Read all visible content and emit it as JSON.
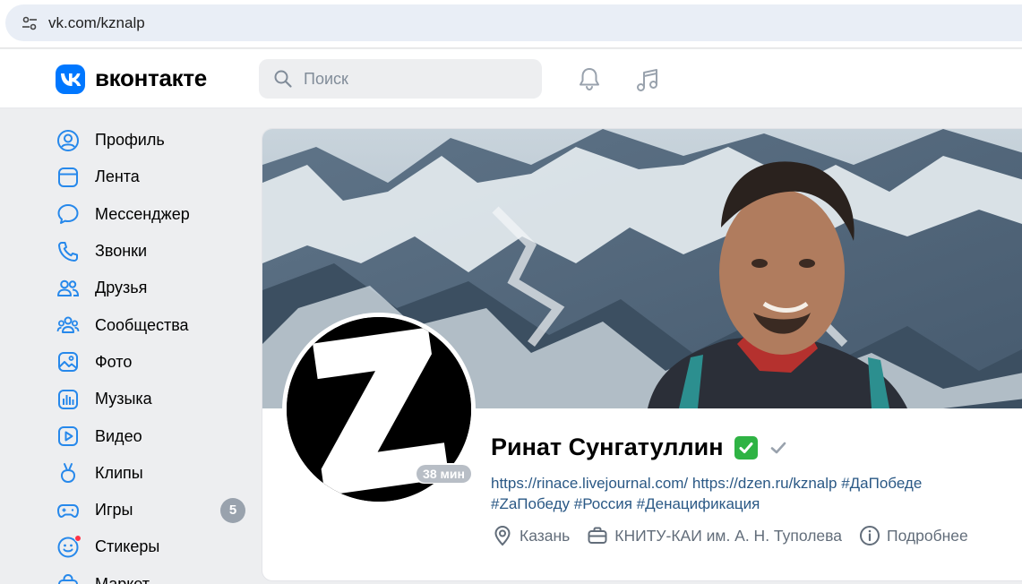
{
  "browser": {
    "url": "vk.com/kznalp"
  },
  "header": {
    "wordmark": "вконтакте",
    "search_placeholder": "Поиск",
    "accent_color": "#0077ff"
  },
  "sidebar": {
    "items": [
      {
        "label": "Профиль",
        "icon": "profile-icon"
      },
      {
        "label": "Лента",
        "icon": "feed-icon"
      },
      {
        "label": "Мессенджер",
        "icon": "messenger-icon"
      },
      {
        "label": "Звонки",
        "icon": "phone-icon"
      },
      {
        "label": "Друзья",
        "icon": "friends-icon"
      },
      {
        "label": "Сообщества",
        "icon": "communities-icon"
      },
      {
        "label": "Фото",
        "icon": "photo-icon"
      },
      {
        "label": "Музыка",
        "icon": "music-icon"
      },
      {
        "label": "Видео",
        "icon": "video-icon"
      },
      {
        "label": "Клипы",
        "icon": "clips-icon"
      },
      {
        "label": "Игры",
        "icon": "games-icon",
        "badge": "5"
      },
      {
        "label": "Стикеры",
        "icon": "stickers-icon"
      },
      {
        "label": "Маркет",
        "icon": "market-icon"
      }
    ]
  },
  "profile": {
    "name": "Ринат Сунгатуллин",
    "emoji": "✅",
    "last_seen": "38 мин",
    "status_line1": "https://rinace.livejournal.com/ https://dzen.ru/kznalp #ДаПобеде",
    "status_line2": "#ZaПобеду #Россия #Денацификация",
    "city": "Казань",
    "education": "КНИТУ-КАИ им. А. Н. Туполева",
    "more_label": "Подробнее",
    "avatar_letter": "Z"
  }
}
